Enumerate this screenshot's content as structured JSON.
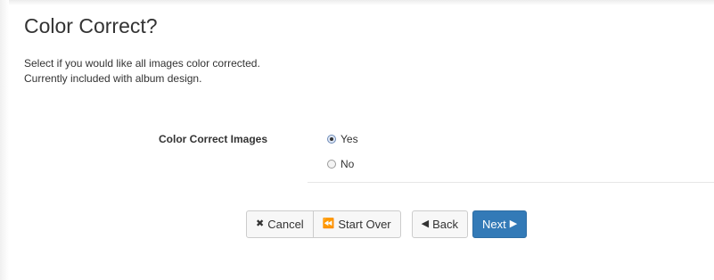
{
  "page": {
    "title": "Color Correct?",
    "description_lines": [
      "Select if you would like all images color corrected.",
      "Currently included with album design."
    ]
  },
  "form": {
    "label": "Color Correct Images",
    "options": [
      {
        "label": "Yes",
        "selected": true
      },
      {
        "label": "No",
        "selected": false
      }
    ]
  },
  "buttons": {
    "cancel": "Cancel",
    "start_over": "Start Over",
    "back": "Back",
    "next": "Next"
  },
  "icons": {
    "cancel": "x-icon",
    "start_over": "double-left-icon",
    "back": "caret-left-icon",
    "next": "caret-right-icon"
  },
  "colors": {
    "primary": "#337ab7",
    "text": "#333333"
  }
}
